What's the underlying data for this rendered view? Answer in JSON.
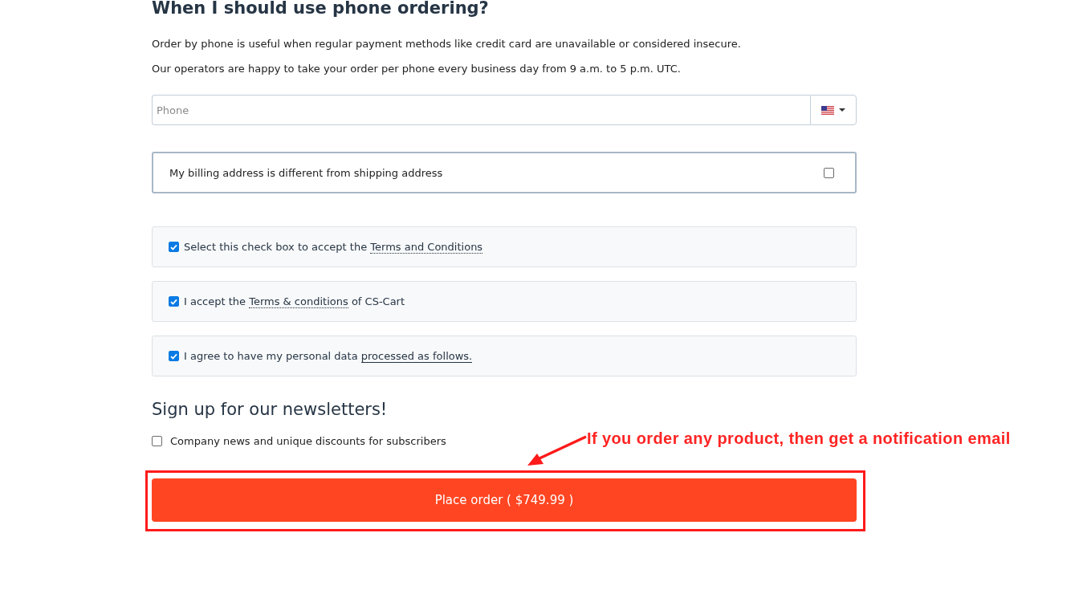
{
  "heading": "When I should use phone ordering?",
  "paragraphs": [
    "Order by phone is useful when regular payment methods like credit card are unavailable or considered insecure.",
    "Our operators are happy to take your order per phone every business day from 9 a.m. to 5 p.m. UTC."
  ],
  "phone_field": {
    "placeholder": "Phone"
  },
  "billing_option": {
    "label": "My billing address is different from shipping address",
    "checked": false
  },
  "agreements": [
    {
      "before": "Select this check box to accept the",
      "link": {
        "text": "Terms and Conditions",
        "kind": "dotted"
      },
      "checked": true
    },
    {
      "before": "I accept the",
      "link": {
        "text": "Terms & conditions",
        "kind": "dotted"
      },
      "after": "of CS-Cart",
      "checked": true
    },
    {
      "before": "I agree to have my personal data",
      "link": {
        "text": "processed as follows.",
        "kind": "solid"
      },
      "checked": true
    }
  ],
  "newsletter": {
    "title": "Sign up for our newsletters!",
    "items": [
      {
        "label": "Company news and unique discounts for subscribers",
        "checked": false
      }
    ]
  },
  "place_order": {
    "label": "Place order ( $749.99 )"
  },
  "annotation": {
    "text": "If you order any product, then get a notification email"
  }
}
